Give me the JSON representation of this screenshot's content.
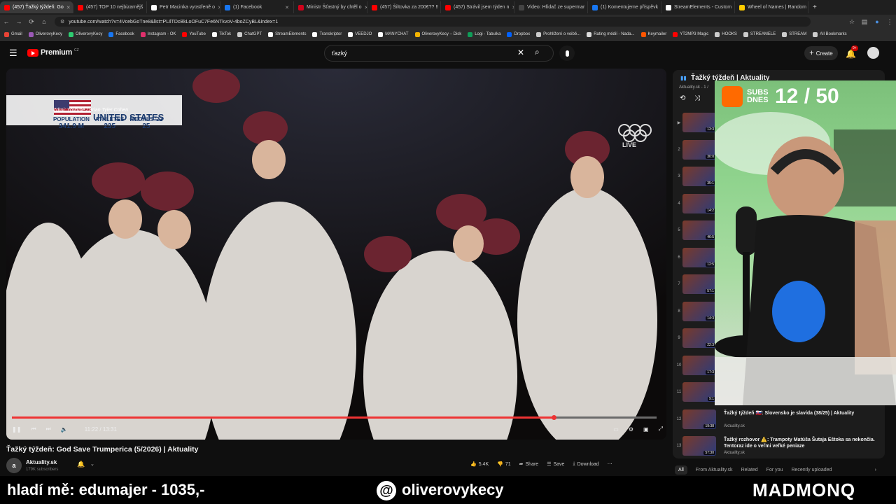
{
  "browser": {
    "tabs": [
      {
        "label": "(457) Ťažký týždeň: Go",
        "color": "#ff0000",
        "active": true
      },
      {
        "label": "(457) TOP 10 nejbizarnějš",
        "color": "#ff0000"
      },
      {
        "label": "Petr Macinka vyostřeně o",
        "color": "#ffffff"
      },
      {
        "label": "(1) Facebook",
        "color": "#1877f2"
      },
      {
        "label": "Ministr Šťastný by chtěl o",
        "color": "#d0021b"
      },
      {
        "label": "(457) Šiltovka za 200€?? ‼",
        "color": "#ff0000"
      },
      {
        "label": "(457) Strávil jsem týden n",
        "color": "#ff0000"
      },
      {
        "label": "Video: Hlídač ze supermar",
        "color": "#444444"
      },
      {
        "label": "(1) Komentujeme příspěvk",
        "color": "#1877f2"
      },
      {
        "label": "StreamElements - Custom",
        "color": "#ffffff"
      },
      {
        "label": "Wheel of Names | Random",
        "color": "#ffcc00"
      }
    ],
    "url": "youtube.com/watch?v=4VcebGoTne8&list=PLIlTDcBkLoOFuC7Fe6NTkvoV-4boZCyBL&index=1",
    "bookmarks": [
      {
        "label": "Gmail",
        "color": "#ea4335"
      },
      {
        "label": "OliverovyKecy",
        "color": "#9b59b6"
      },
      {
        "label": "OliverovyKecy",
        "color": "#2ecc71"
      },
      {
        "label": "Facebook",
        "color": "#1877f2"
      },
      {
        "label": "Instagram - OK",
        "color": "#e1306c"
      },
      {
        "label": "YouTube",
        "color": "#ff0000"
      },
      {
        "label": "TikTok",
        "color": "#ffffff"
      },
      {
        "label": "ChatGPT",
        "color": "#cccccc"
      },
      {
        "label": "StreamElements",
        "color": "#ffffff"
      },
      {
        "label": "Transkriptor",
        "color": "#ffffff"
      },
      {
        "label": "VEEDJO",
        "color": "#ffffff"
      },
      {
        "label": "MANYCHAT",
        "color": "#ffffff"
      },
      {
        "label": "OliverovyKecy – Disk",
        "color": "#f4b400"
      },
      {
        "label": "Logi - Tabulka",
        "color": "#0f9d58"
      },
      {
        "label": "Dropbox",
        "color": "#0061ff"
      },
      {
        "label": "Prohlížení o voibě...",
        "color": "#cccccc"
      },
      {
        "label": "Rating médií - Nada...",
        "color": "#dddddd"
      },
      {
        "label": "Keymailer",
        "color": "#ff5500"
      },
      {
        "label": "YT2MP3 Magic",
        "color": "#ff0000"
      },
      {
        "label": "HOOKS",
        "color": "#cccccc"
      },
      {
        "label": "STREAMELE",
        "color": "#cccccc"
      },
      {
        "label": "STREAM",
        "color": "#cccccc"
      },
      {
        "label": "All Bookmarks",
        "color": "#cccccc"
      }
    ]
  },
  "youtube": {
    "logo": "Premium",
    "logo_superscript": "CZ",
    "search_value": "ťazký",
    "create_label": "Create",
    "notif_count": "9+",
    "video": {
      "title": "Ťažký týždeň: God Save Trumperica (5/2026) | Aktuality",
      "time": "11:22 / 13:31",
      "progress": 0.84,
      "overlay_source": "Zdroj: Youtube / Brian Tyler Cohen",
      "overlay_country": "UNITED STATES",
      "overlay_stats": [
        {
          "label": "POPULATION",
          "value": "341.9 M"
        },
        {
          "label": "ATHLETES",
          "value": "235"
        },
        {
          "label": "MEDALS '22",
          "value": "25"
        }
      ],
      "live_label": "LIVE"
    },
    "channel": {
      "name": "Aktuality.sk",
      "subs": "179K subscribers",
      "avatar_text": "a"
    },
    "actions": {
      "likes": "5.4K",
      "dislikes": "71",
      "share": "Share",
      "save": "Save",
      "download": "Download"
    },
    "playlist": {
      "title": "Ťažký týždeň | Aktuality",
      "subtitle": "Aktuality.sk - 1 /",
      "items": [
        {
          "num": "▶",
          "dur": "13:3",
          "title": "",
          "chan": ""
        },
        {
          "num": "2",
          "dur": "30:0",
          "title": "",
          "chan": ""
        },
        {
          "num": "3",
          "dur": "35:1",
          "title": "",
          "chan": ""
        },
        {
          "num": "4",
          "dur": "14:2",
          "title": "",
          "chan": ""
        },
        {
          "num": "5",
          "dur": "46:5",
          "title": "",
          "chan": ""
        },
        {
          "num": "6",
          "dur": "12:5",
          "title": "",
          "chan": ""
        },
        {
          "num": "7",
          "dur": "57:1",
          "title": "",
          "chan": ""
        },
        {
          "num": "8",
          "dur": "14:3",
          "title": "",
          "chan": ""
        },
        {
          "num": "9",
          "dur": "22:3",
          "title": "",
          "chan": ""
        },
        {
          "num": "10",
          "dur": "17:3",
          "title": "",
          "chan": ""
        },
        {
          "num": "11",
          "dur": "9:1",
          "title": "",
          "chan": ""
        },
        {
          "num": "12",
          "dur": "19:38",
          "title": "Ťažký týždeň 🇸🇰: Slovensko je slavída (38/25) | Aktuality",
          "chan": "Aktuality.sk"
        },
        {
          "num": "13",
          "dur": "57:30",
          "title": "Ťažký rozhovor ⚠️: Trampoty Matúša Šutaja Eštoka sa nekončia. Tentoraz ide o veľmi veľké peniaze",
          "chan": "Aktuality.sk"
        }
      ]
    },
    "chips": [
      "All",
      "From Aktuality.sk",
      "Related",
      "For you",
      "Recently uploaded"
    ]
  },
  "stream": {
    "subs_label": "SUBS DNES",
    "subs_count": "12 / 50",
    "bottom_left": "hladí mě: edumajer - 1035,-",
    "bottom_center": "oliverovykecy",
    "bottom_right": "MADMONQ",
    "accent": "#ffd200"
  }
}
